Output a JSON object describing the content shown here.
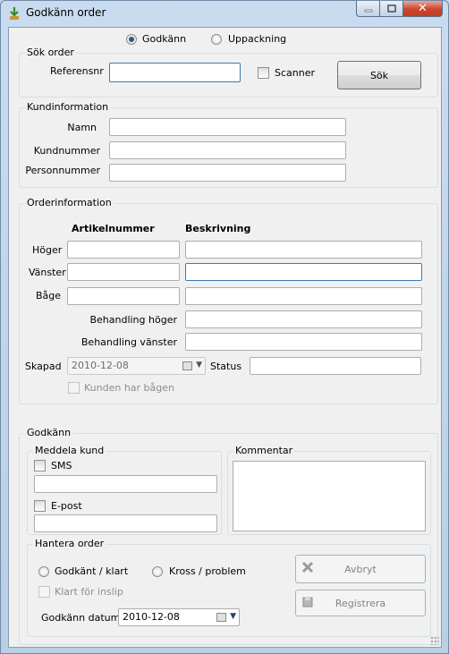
{
  "window": {
    "title": "Godkänn order"
  },
  "mode": {
    "opt1": "Godkänn",
    "opt2": "Uppackning",
    "selected": "Godkänn"
  },
  "sok": {
    "title": "Sök order",
    "ref_label": "Referensnr",
    "ref_value": "",
    "scanner_label": "Scanner",
    "button": "Sök"
  },
  "kund": {
    "title": "Kundinformation",
    "namn": "Namn",
    "kundnummer": "Kundnummer",
    "personnummer": "Personnummer"
  },
  "order": {
    "title": "Orderinformation",
    "col_art": "Artikelnummer",
    "col_besk": "Beskrivning",
    "hoger": "Höger",
    "vanster": "Vänster",
    "bage": "Båge",
    "beh_hoger": "Behandling höger",
    "beh_vanster": "Behandling vänster",
    "skapad": "Skapad",
    "skapad_value": "2010-12-08",
    "status": "Status",
    "kunden_label": "Kunden har bågen"
  },
  "godkann": {
    "title": "Godkänn",
    "meddela": "Meddela kund",
    "sms": "SMS",
    "epost": "E-post",
    "kommentar": "Kommentar",
    "hantera": "Hantera order",
    "godkant": "Godkänt / klart",
    "kross": "Kross / problem",
    "klart": "Klart för inslip",
    "datum_label": "Godkänn datum",
    "datum_value": "2010-12-08",
    "avbryt": "Avbryt",
    "registrera": "Registrera"
  }
}
